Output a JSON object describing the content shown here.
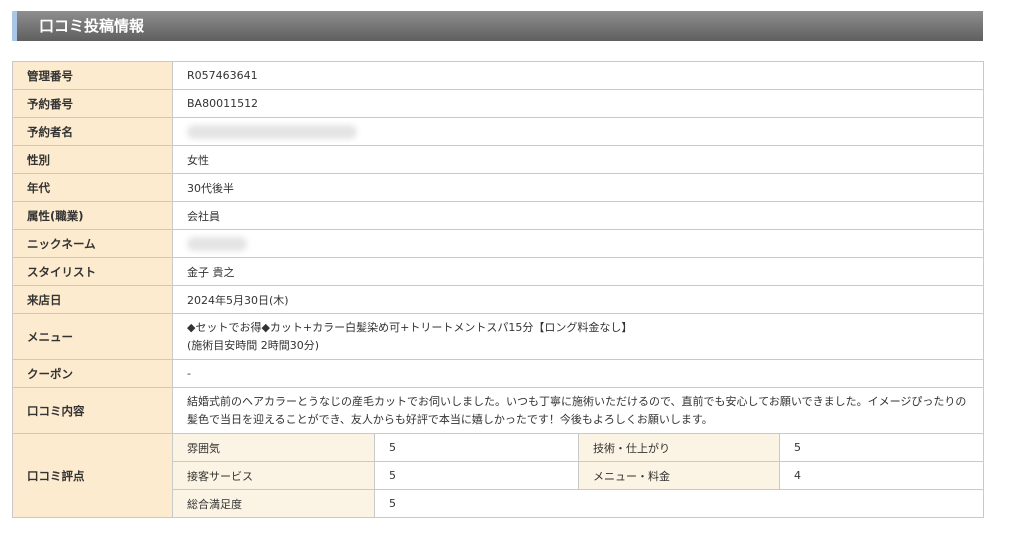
{
  "header": {
    "title": "口コミ投稿情報"
  },
  "info": {
    "management_no": {
      "label": "管理番号",
      "value": "R057463641"
    },
    "reservation_no": {
      "label": "予約番号",
      "value": "BA80011512"
    },
    "reserver_name": {
      "label": "予約者名"
    },
    "gender": {
      "label": "性別",
      "value": "女性"
    },
    "age": {
      "label": "年代",
      "value": "30代後半"
    },
    "occupation": {
      "label": "属性(職業)",
      "value": "会社員"
    },
    "nickname": {
      "label": "ニックネーム"
    },
    "stylist": {
      "label": "スタイリスト",
      "value": "金子 貴之"
    },
    "visit_date": {
      "label": "来店日",
      "value": "2024年5月30日(木)"
    },
    "menu": {
      "label": "メニュー",
      "line1": "◆セットでお得◆カット+カラー白髪染め可+トリートメントスパ15分【ロング料金なし】",
      "line2": "(施術目安時間 2時間30分)"
    },
    "coupon": {
      "label": "クーポン",
      "value": "-"
    },
    "review": {
      "label": "口コミ内容",
      "text": "結婚式前のヘアカラーとうなじの産毛カットでお伺いしました。いつも丁寧に施術いただけるので、直前でも安心してお願いできました。イメージぴったりの髪色で当日を迎えることができ、友人からも好評で本当に嬉しかったです！今後もよろしくお願いします。"
    },
    "scores": {
      "label": "口コミ評点",
      "atmosphere": {
        "label": "雰囲気",
        "value": "5"
      },
      "technique": {
        "label": "技術・仕上がり",
        "value": "5"
      },
      "service": {
        "label": "接客サービス",
        "value": "5"
      },
      "menu_price": {
        "label": "メニュー・料金",
        "value": "4"
      },
      "overall": {
        "label": "総合満足度",
        "value": "5"
      }
    }
  }
}
